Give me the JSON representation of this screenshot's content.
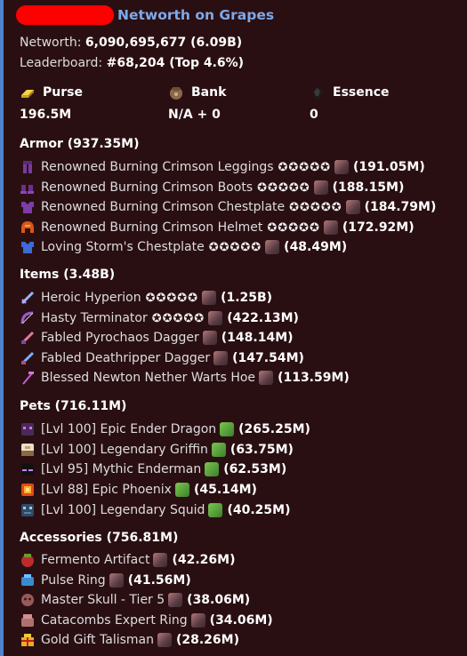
{
  "title": "Networth on Grapes",
  "summary": {
    "networth_label": "Networth: ",
    "networth_value": "6,090,695,677 (6.09B)",
    "leaderboard_label": "Leaderboard: ",
    "leaderboard_value": "#68,204 (Top 4.6%)"
  },
  "stats": [
    {
      "label": "Purse",
      "value": "196.5M",
      "icon": "gold-ingot-icon"
    },
    {
      "label": "Bank",
      "value": "N/A + 0",
      "icon": "bank-icon"
    },
    {
      "label": "Essence",
      "value": "0",
      "icon": "essence-icon"
    }
  ],
  "sections": {
    "armor": {
      "title": "Armor (937.35M)",
      "items": [
        {
          "name": "Renowned Burning Crimson Leggings",
          "stars": "✪✪✪✪✪",
          "value": "(191.05M)",
          "icon": "leggings-icon"
        },
        {
          "name": "Renowned Burning Crimson Boots",
          "stars": "✪✪✪✪✪",
          "value": "(188.15M)",
          "icon": "boots-icon"
        },
        {
          "name": "Renowned Burning Crimson Chestplate",
          "stars": "✪✪✪✪✪",
          "value": "(184.79M)",
          "icon": "chestplate-icon"
        },
        {
          "name": "Renowned Burning Crimson Helmet",
          "stars": "✪✪✪✪✪",
          "value": "(172.92M)",
          "icon": "helmet-icon"
        },
        {
          "name": "Loving Storm's Chestplate",
          "stars": "✪✪✪✪✪",
          "value": "(48.49M)",
          "icon": "chestplate-icon"
        }
      ]
    },
    "items": {
      "title": "Items (3.48B)",
      "items": [
        {
          "name": "Heroic Hyperion",
          "stars": "✪✪✪✪✪",
          "value": "(1.25B)",
          "icon": "sword-icon"
        },
        {
          "name": "Hasty Terminator",
          "stars": "✪✪✪✪✪",
          "value": "(422.13M)",
          "icon": "bow-icon"
        },
        {
          "name": "Fabled Pyrochaos Dagger",
          "stars": "",
          "value": "(148.14M)",
          "icon": "dagger-icon"
        },
        {
          "name": "Fabled Deathripper Dagger",
          "stars": "",
          "value": "(147.54M)",
          "icon": "dagger-icon"
        },
        {
          "name": "Blessed Newton Nether Warts Hoe",
          "stars": "",
          "value": "(113.59M)",
          "icon": "hoe-icon"
        }
      ]
    },
    "pets": {
      "title": "Pets (716.11M)",
      "items": [
        {
          "name": "[Lvl 100] Epic Ender Dragon",
          "value": "(265.25M)",
          "icon": "ender-dragon-icon"
        },
        {
          "name": "[Lvl 100] Legendary Griffin",
          "value": "(63.75M)",
          "icon": "griffin-icon"
        },
        {
          "name": "[Lvl 95] Mythic Enderman",
          "value": "(62.53M)",
          "icon": "enderman-icon"
        },
        {
          "name": "[Lvl 88] Epic Phoenix",
          "value": "(45.14M)",
          "icon": "phoenix-icon"
        },
        {
          "name": "[Lvl 100] Legendary Squid",
          "value": "(40.25M)",
          "icon": "squid-icon"
        }
      ]
    },
    "accessories": {
      "title": "Accessories (756.81M)",
      "items": [
        {
          "name": "Fermento Artifact",
          "value": "(42.26M)",
          "icon": "artifact-icon"
        },
        {
          "name": "Pulse Ring",
          "value": "(41.56M)",
          "icon": "ring-icon"
        },
        {
          "name": "Master Skull - Tier 5",
          "value": "(38.06M)",
          "icon": "skull-icon"
        },
        {
          "name": "Catacombs Expert Ring",
          "value": "(34.06M)",
          "icon": "ring-icon"
        },
        {
          "name": "Gold Gift Talisman",
          "value": "(28.26M)",
          "icon": "gift-icon"
        }
      ]
    }
  },
  "colors": {
    "accent": "#4f83cc",
    "title": "#7da9e8",
    "background": "#2a0f12"
  }
}
